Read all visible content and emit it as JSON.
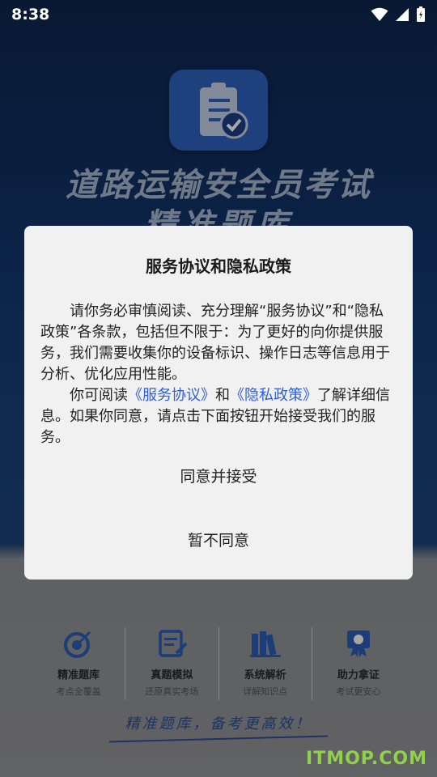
{
  "status_bar": {
    "time": "8:38"
  },
  "splash": {
    "title": "道路运输安全员考试",
    "subtitle": "精准题库",
    "features": [
      {
        "icon": "target-icon",
        "label": "精准题库",
        "sub": "考点全覆盖"
      },
      {
        "icon": "exam-paper-icon",
        "label": "真题模拟",
        "sub": "还原真实考场"
      },
      {
        "icon": "books-icon",
        "label": "系统解析",
        "sub": "详解知识点"
      },
      {
        "icon": "certificate-icon",
        "label": "助力拿证",
        "sub": "考试更安心"
      }
    ],
    "slogan": "精准题库，备考更高效！"
  },
  "dialog": {
    "title": "服务协议和隐私政策",
    "para1": "请你务必审慎阅读、充分理解“服务协议”和“隐私政策”各条款，包括但不限于：为了更好的向你提供服务，我们需要收集你的设备标识、操作日志等信息用于分析、优化应用性能。",
    "para2_prefix": "你可阅读",
    "link_service": "《服务协议》",
    "para2_and": "和",
    "link_privacy": "《隐私政策》",
    "para2_suffix": "了解详细信息。如果你同意，请点击下面按钮开始接受我们的服务。",
    "agree_label": "同意并接受",
    "disagree_label": "暂不同意"
  },
  "watermark": "ITMOP.COM",
  "colors": {
    "link": "#2f5fd6",
    "dialog_bg": "#f1f1f1",
    "brand_blue": "#1d56ad"
  }
}
